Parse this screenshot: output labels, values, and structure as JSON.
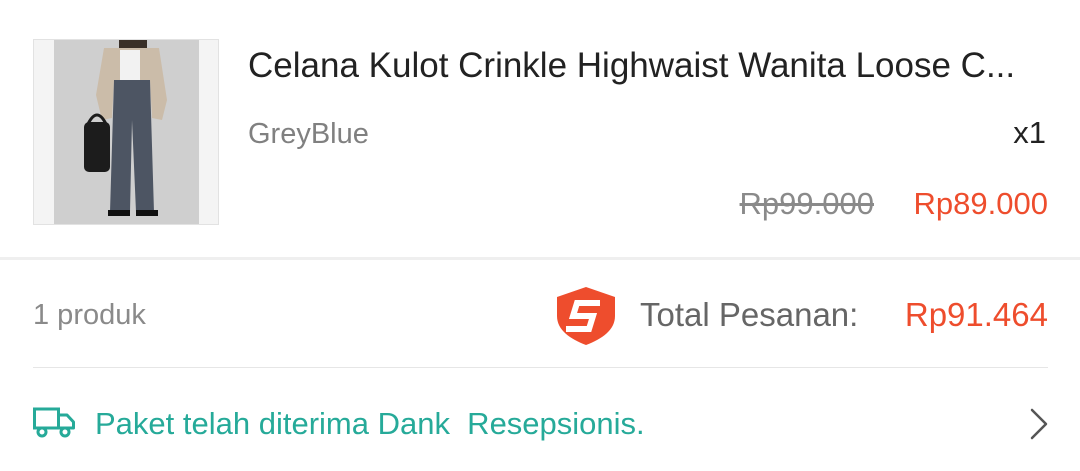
{
  "product": {
    "title": "Celana Kulot Crinkle Highwaist Wanita Loose C...",
    "variation": "GreyBlue",
    "quantity": "x1",
    "original_price": "Rp99.000",
    "price": "Rp89.000",
    "image_icon": "product-photo"
  },
  "summary": {
    "count": "1 produk",
    "total_label": "Total Pesanan:",
    "total_value": "Rp91.464",
    "shield_icon": "shopee-guarantee-shield-icon"
  },
  "shipping": {
    "status": "Paket telah diterima Dank  Resepsionis.",
    "truck_icon": "truck-icon",
    "chevron_icon": "chevron-right-icon"
  },
  "colors": {
    "accent": "#ee4d2d",
    "shipping_green": "#26aa99",
    "muted_text": "#8a8a8a"
  }
}
